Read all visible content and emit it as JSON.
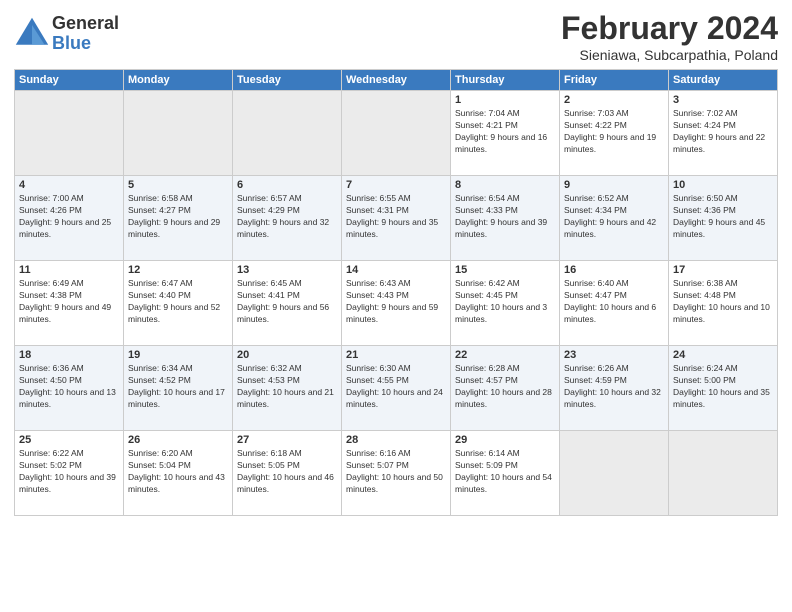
{
  "logo": {
    "line1": "General",
    "line2": "Blue"
  },
  "title": "February 2024",
  "subtitle": "Sieniawa, Subcarpathia, Poland",
  "weekdays": [
    "Sunday",
    "Monday",
    "Tuesday",
    "Wednesday",
    "Thursday",
    "Friday",
    "Saturday"
  ],
  "weeks": [
    [
      {
        "day": "",
        "sunrise": "",
        "sunset": "",
        "daylight": "",
        "empty": true
      },
      {
        "day": "",
        "sunrise": "",
        "sunset": "",
        "daylight": "",
        "empty": true
      },
      {
        "day": "",
        "sunrise": "",
        "sunset": "",
        "daylight": "",
        "empty": true
      },
      {
        "day": "",
        "sunrise": "",
        "sunset": "",
        "daylight": "",
        "empty": true
      },
      {
        "day": "1",
        "sunrise": "Sunrise: 7:04 AM",
        "sunset": "Sunset: 4:21 PM",
        "daylight": "Daylight: 9 hours and 16 minutes."
      },
      {
        "day": "2",
        "sunrise": "Sunrise: 7:03 AM",
        "sunset": "Sunset: 4:22 PM",
        "daylight": "Daylight: 9 hours and 19 minutes."
      },
      {
        "day": "3",
        "sunrise": "Sunrise: 7:02 AM",
        "sunset": "Sunset: 4:24 PM",
        "daylight": "Daylight: 9 hours and 22 minutes."
      }
    ],
    [
      {
        "day": "4",
        "sunrise": "Sunrise: 7:00 AM",
        "sunset": "Sunset: 4:26 PM",
        "daylight": "Daylight: 9 hours and 25 minutes."
      },
      {
        "day": "5",
        "sunrise": "Sunrise: 6:58 AM",
        "sunset": "Sunset: 4:27 PM",
        "daylight": "Daylight: 9 hours and 29 minutes."
      },
      {
        "day": "6",
        "sunrise": "Sunrise: 6:57 AM",
        "sunset": "Sunset: 4:29 PM",
        "daylight": "Daylight: 9 hours and 32 minutes."
      },
      {
        "day": "7",
        "sunrise": "Sunrise: 6:55 AM",
        "sunset": "Sunset: 4:31 PM",
        "daylight": "Daylight: 9 hours and 35 minutes."
      },
      {
        "day": "8",
        "sunrise": "Sunrise: 6:54 AM",
        "sunset": "Sunset: 4:33 PM",
        "daylight": "Daylight: 9 hours and 39 minutes."
      },
      {
        "day": "9",
        "sunrise": "Sunrise: 6:52 AM",
        "sunset": "Sunset: 4:34 PM",
        "daylight": "Daylight: 9 hours and 42 minutes."
      },
      {
        "day": "10",
        "sunrise": "Sunrise: 6:50 AM",
        "sunset": "Sunset: 4:36 PM",
        "daylight": "Daylight: 9 hours and 45 minutes."
      }
    ],
    [
      {
        "day": "11",
        "sunrise": "Sunrise: 6:49 AM",
        "sunset": "Sunset: 4:38 PM",
        "daylight": "Daylight: 9 hours and 49 minutes."
      },
      {
        "day": "12",
        "sunrise": "Sunrise: 6:47 AM",
        "sunset": "Sunset: 4:40 PM",
        "daylight": "Daylight: 9 hours and 52 minutes."
      },
      {
        "day": "13",
        "sunrise": "Sunrise: 6:45 AM",
        "sunset": "Sunset: 4:41 PM",
        "daylight": "Daylight: 9 hours and 56 minutes."
      },
      {
        "day": "14",
        "sunrise": "Sunrise: 6:43 AM",
        "sunset": "Sunset: 4:43 PM",
        "daylight": "Daylight: 9 hours and 59 minutes."
      },
      {
        "day": "15",
        "sunrise": "Sunrise: 6:42 AM",
        "sunset": "Sunset: 4:45 PM",
        "daylight": "Daylight: 10 hours and 3 minutes."
      },
      {
        "day": "16",
        "sunrise": "Sunrise: 6:40 AM",
        "sunset": "Sunset: 4:47 PM",
        "daylight": "Daylight: 10 hours and 6 minutes."
      },
      {
        "day": "17",
        "sunrise": "Sunrise: 6:38 AM",
        "sunset": "Sunset: 4:48 PM",
        "daylight": "Daylight: 10 hours and 10 minutes."
      }
    ],
    [
      {
        "day": "18",
        "sunrise": "Sunrise: 6:36 AM",
        "sunset": "Sunset: 4:50 PM",
        "daylight": "Daylight: 10 hours and 13 minutes."
      },
      {
        "day": "19",
        "sunrise": "Sunrise: 6:34 AM",
        "sunset": "Sunset: 4:52 PM",
        "daylight": "Daylight: 10 hours and 17 minutes."
      },
      {
        "day": "20",
        "sunrise": "Sunrise: 6:32 AM",
        "sunset": "Sunset: 4:53 PM",
        "daylight": "Daylight: 10 hours and 21 minutes."
      },
      {
        "day": "21",
        "sunrise": "Sunrise: 6:30 AM",
        "sunset": "Sunset: 4:55 PM",
        "daylight": "Daylight: 10 hours and 24 minutes."
      },
      {
        "day": "22",
        "sunrise": "Sunrise: 6:28 AM",
        "sunset": "Sunset: 4:57 PM",
        "daylight": "Daylight: 10 hours and 28 minutes."
      },
      {
        "day": "23",
        "sunrise": "Sunrise: 6:26 AM",
        "sunset": "Sunset: 4:59 PM",
        "daylight": "Daylight: 10 hours and 32 minutes."
      },
      {
        "day": "24",
        "sunrise": "Sunrise: 6:24 AM",
        "sunset": "Sunset: 5:00 PM",
        "daylight": "Daylight: 10 hours and 35 minutes."
      }
    ],
    [
      {
        "day": "25",
        "sunrise": "Sunrise: 6:22 AM",
        "sunset": "Sunset: 5:02 PM",
        "daylight": "Daylight: 10 hours and 39 minutes."
      },
      {
        "day": "26",
        "sunrise": "Sunrise: 6:20 AM",
        "sunset": "Sunset: 5:04 PM",
        "daylight": "Daylight: 10 hours and 43 minutes."
      },
      {
        "day": "27",
        "sunrise": "Sunrise: 6:18 AM",
        "sunset": "Sunset: 5:05 PM",
        "daylight": "Daylight: 10 hours and 46 minutes."
      },
      {
        "day": "28",
        "sunrise": "Sunrise: 6:16 AM",
        "sunset": "Sunset: 5:07 PM",
        "daylight": "Daylight: 10 hours and 50 minutes."
      },
      {
        "day": "29",
        "sunrise": "Sunrise: 6:14 AM",
        "sunset": "Sunset: 5:09 PM",
        "daylight": "Daylight: 10 hours and 54 minutes."
      },
      {
        "day": "",
        "sunrise": "",
        "sunset": "",
        "daylight": "",
        "empty": true
      },
      {
        "day": "",
        "sunrise": "",
        "sunset": "",
        "daylight": "",
        "empty": true
      }
    ]
  ]
}
